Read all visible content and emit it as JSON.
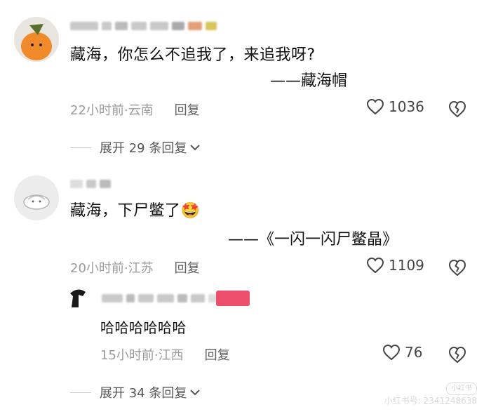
{
  "comments": [
    {
      "text": "藏海，你怎么不追我了，来追我呀?",
      "signature": "——藏海帽",
      "time_location": "22小时前·云南",
      "reply_label": "回复",
      "likes": "1036",
      "expand_label": "展开 29 条回复"
    },
    {
      "text": "藏海，下尸鳖了",
      "emoji": "🤩",
      "signature": "——《一闪一闪尸鳖晶》",
      "time_location": "20小时前·江苏",
      "reply_label": "回复",
      "likes": "1109",
      "reply": {
        "text": "哈哈哈哈哈哈",
        "time_location": "15小时前·江西",
        "reply_label": "回复",
        "likes": "76"
      },
      "expand_label": "展开 34 条回复"
    }
  ],
  "watermark": {
    "logo": "小红书",
    "id": "小红书号: 2341248638"
  },
  "colors": {
    "meta_gray": "#9b9b9b",
    "badge_red": "#ec4e6c",
    "avatar_orange": "#f08a2a"
  }
}
